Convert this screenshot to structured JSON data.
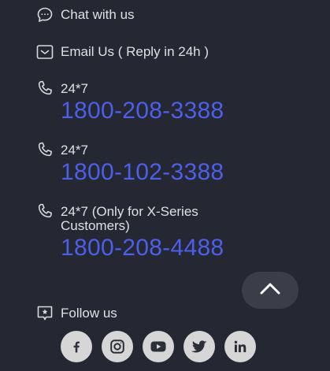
{
  "contact": {
    "chat_label": "Chat with us",
    "email_label": "Email Us ( Reply in 24h )",
    "phones": [
      {
        "label": "24*7",
        "number": "1800-208-3388"
      },
      {
        "label": "24*7",
        "number": "1800-102-3388"
      },
      {
        "label": "24*7 (Only for X-Series Customers)",
        "number": "1800-208-4488"
      }
    ]
  },
  "follow": {
    "label": "Follow us",
    "socials": [
      "facebook-icon",
      "instagram-icon",
      "youtube-icon",
      "twitter-icon",
      "linkedin-icon"
    ]
  },
  "colors": {
    "background": "#252833",
    "phone": "#4d5ee8",
    "social_bg": "#d6d6d6",
    "top_button": "#3b3e48"
  }
}
